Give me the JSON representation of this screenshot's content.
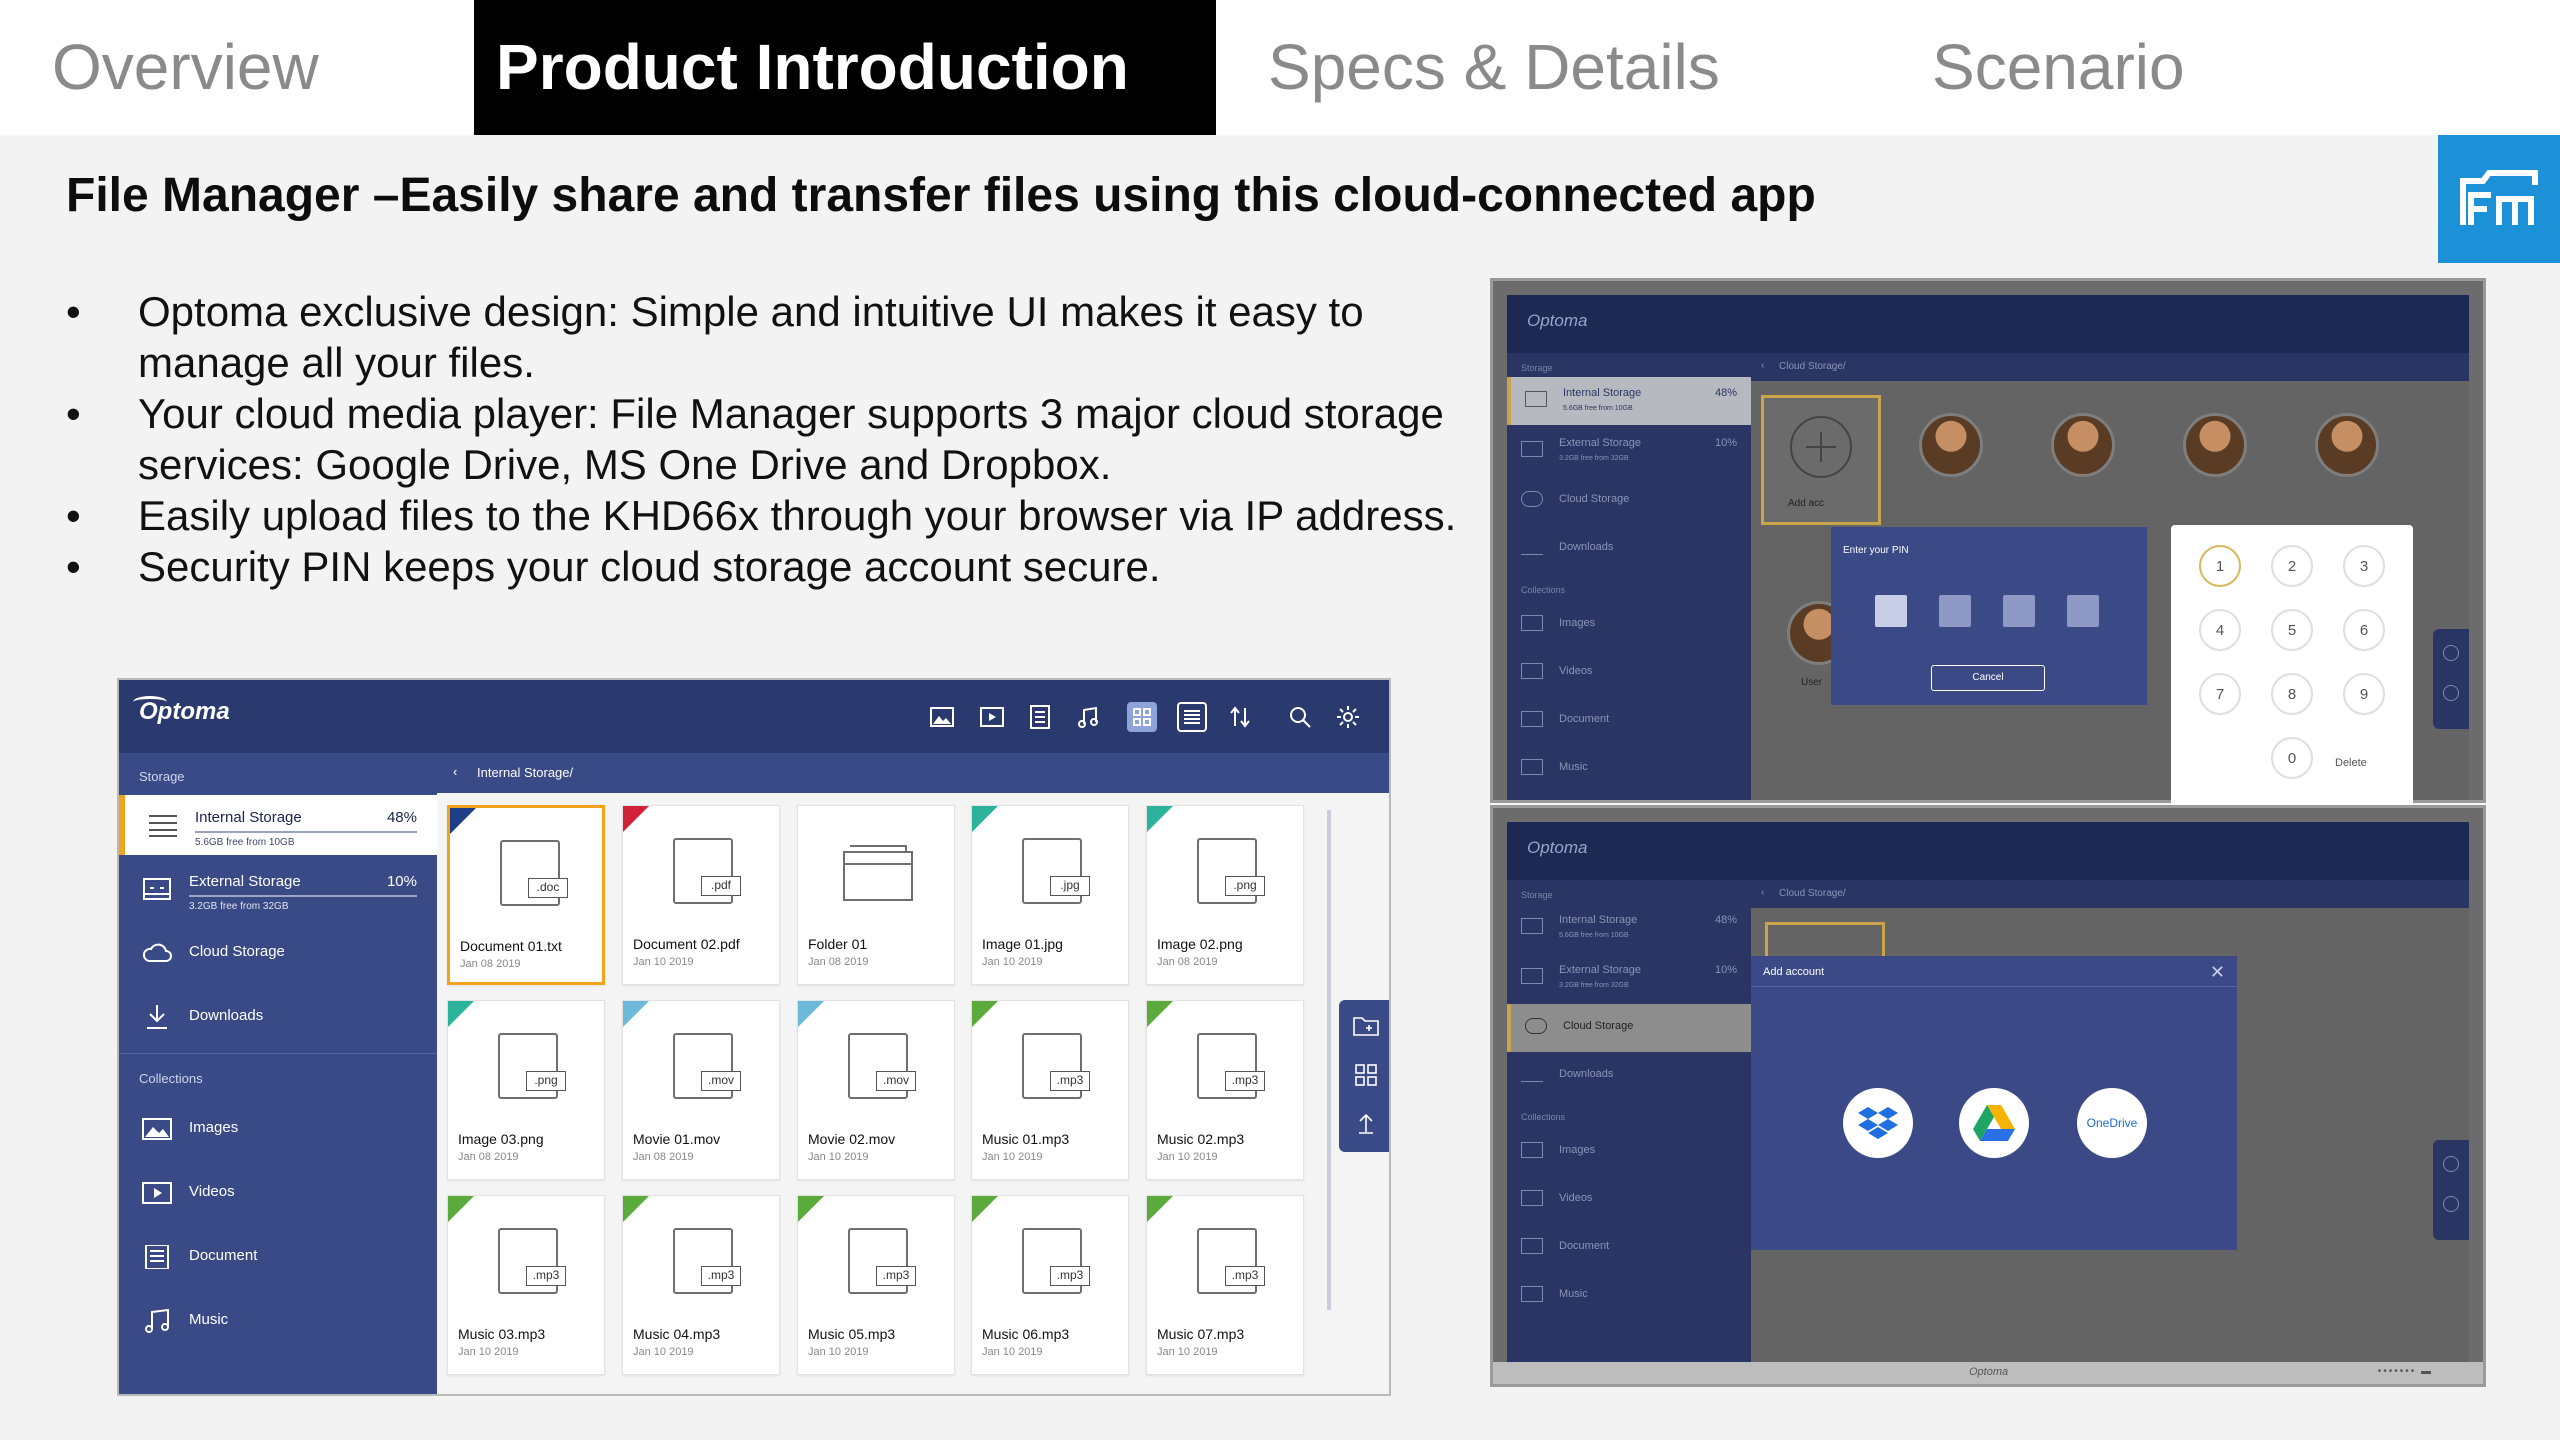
{
  "tabs": [
    {
      "label": "Overview",
      "active": false
    },
    {
      "label": "Product Introduction",
      "active": true
    },
    {
      "label": "Specs & Details",
      "active": false
    },
    {
      "label": "Scenario",
      "active": false
    }
  ],
  "headline": "File Manager –Easily share and transfer files using this cloud-connected app",
  "bullets": [
    "Optoma exclusive design: Simple and intuitive UI makes it easy to manage all your files.",
    "Your cloud media player: File Manager supports 3 major cloud storage services: Google Drive, MS One Drive and Dropbox.",
    "Easily upload files to the KHD66x through your browser via IP address.",
    "Security PIN keeps your cloud storage account secure."
  ],
  "colors": {
    "accent": "#1d91d8",
    "nav": "#2b3a6e",
    "sidebar": "#3a4a86",
    "selection": "#f3a21c"
  },
  "file_manager": {
    "brand": "Optoma",
    "breadcrumb": "Internal Storage/",
    "sidebar": {
      "storage_heading": "Storage",
      "internal": {
        "label": "Internal Storage",
        "percent": "48%",
        "sub": "5.6GB free from 10GB"
      },
      "external": {
        "label": "External Storage",
        "percent": "10%",
        "sub": "3.2GB free from 32GB"
      },
      "cloud": "Cloud Storage",
      "downloads": "Downloads",
      "collections_heading": "Collections",
      "images": "Images",
      "videos": "Videos",
      "document": "Document",
      "music": "Music"
    },
    "files": [
      {
        "name": "Document 01.txt",
        "date": "Jan 08 2019",
        "ext": ".doc",
        "corner": "#1f3e88",
        "selected": true
      },
      {
        "name": "Document 02.pdf",
        "date": "Jan 10 2019",
        "ext": ".pdf",
        "corner": "#d0233a",
        "selected": false
      },
      {
        "name": "Folder 01",
        "date": "Jan 08 2019",
        "ext": "",
        "corner": "",
        "selected": false
      },
      {
        "name": "Image 01.jpg",
        "date": "Jan 10 2019",
        "ext": ".jpg",
        "corner": "#2bb39b",
        "selected": false
      },
      {
        "name": "Image 02.png",
        "date": "Jan 08 2019",
        "ext": ".png",
        "corner": "#2bb39b",
        "selected": false
      },
      {
        "name": "Image 03.png",
        "date": "Jan 08 2019",
        "ext": ".png",
        "corner": "#2bb39b",
        "selected": false
      },
      {
        "name": "Movie 01.mov",
        "date": "Jan 08 2019",
        "ext": ".mov",
        "corner": "#6bb8d8",
        "selected": false
      },
      {
        "name": "Movie 02.mov",
        "date": "Jan 10 2019",
        "ext": ".mov",
        "corner": "#6bb8d8",
        "selected": false
      },
      {
        "name": "Music 01.mp3",
        "date": "Jan 10 2019",
        "ext": ".mp3",
        "corner": "#5aab3c",
        "selected": false
      },
      {
        "name": "Music 02.mp3",
        "date": "Jan 10 2019",
        "ext": ".mp3",
        "corner": "#5aab3c",
        "selected": false
      },
      {
        "name": "Music 03.mp3",
        "date": "Jan 10 2019",
        "ext": ".mp3",
        "corner": "#5aab3c",
        "selected": false
      },
      {
        "name": "Music 04.mp3",
        "date": "Jan 10 2019",
        "ext": ".mp3",
        "corner": "#5aab3c",
        "selected": false
      },
      {
        "name": "Music 05.mp3",
        "date": "Jan 10 2019",
        "ext": ".mp3",
        "corner": "#5aab3c",
        "selected": false
      },
      {
        "name": "Music 06.mp3",
        "date": "Jan 10 2019",
        "ext": ".mp3",
        "corner": "#5aab3c",
        "selected": false
      },
      {
        "name": "Music 07.mp3",
        "date": "Jan 10 2019",
        "ext": ".mp3",
        "corner": "#5aab3c",
        "selected": false
      }
    ]
  },
  "device_pin": {
    "brand": "Optoma",
    "breadcrumb": "Cloud Storage/",
    "storage_heading": "Storage",
    "internal": {
      "label": "Internal Storage",
      "percent": "48%",
      "sub": "5.6GB free from 10GB"
    },
    "external": {
      "label": "External Storage",
      "percent": "10%",
      "sub": "3.2GB free from 32GB"
    },
    "cloud": "Cloud Storage",
    "downloads": "Downloads",
    "collections_heading": "Collections",
    "images": "Images",
    "videos": "Videos",
    "document": "Document",
    "music": "Music",
    "add_account_partial": "Add acc",
    "user_partial": "User",
    "pin_title": "Enter your PIN",
    "cancel": "Cancel",
    "keys": [
      "1",
      "2",
      "3",
      "4",
      "5",
      "6",
      "7",
      "8",
      "9",
      "0"
    ],
    "delete": "Delete"
  },
  "device_add": {
    "brand": "Optoma",
    "breadcrumb": "Cloud Storage/",
    "storage_heading": "Storage",
    "internal": {
      "label": "Internal Storage",
      "percent": "48%",
      "sub": "5.6GB free from 10GB"
    },
    "external": {
      "label": "External Storage",
      "percent": "10%",
      "sub": "3.2GB free from 32GB"
    },
    "cloud": "Cloud Storage",
    "downloads": "Downloads",
    "collections_heading": "Collections",
    "images": "Images",
    "videos": "Videos",
    "document": "Document",
    "music": "Music",
    "dialog_title": "Add account",
    "onedrive": "OneDrive",
    "bezel_brand": "Optoma"
  }
}
